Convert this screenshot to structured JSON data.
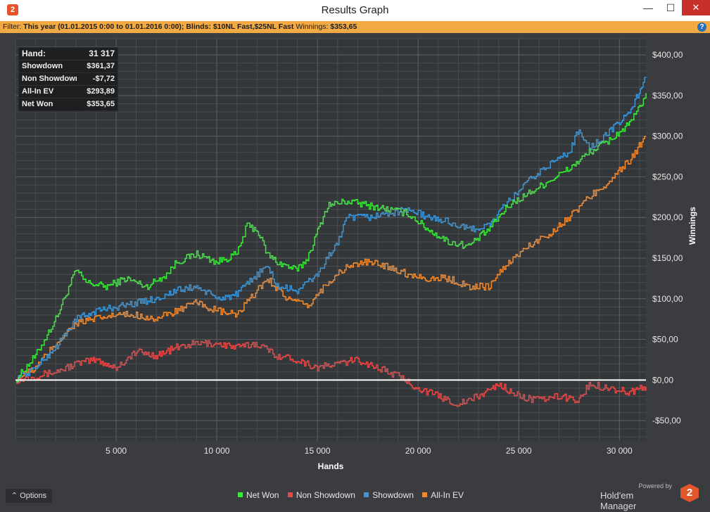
{
  "window": {
    "title": "Results Graph",
    "minimize_glyph": "—",
    "maximize_glyph": "☐",
    "close_glyph": "✕"
  },
  "filter": {
    "label": "Filter:",
    "value": "This year (01.01.2015 0:00 to 01.01.2016 0:00); Blinds: $10NL Fast,$25NL Fast",
    "winnings_label": "Winnings:",
    "winnings_value": "$353,65",
    "help_glyph": "?"
  },
  "stats": [
    {
      "label": "Hand:",
      "value": "31 317"
    },
    {
      "label": "Showdown",
      "value": "$361,37"
    },
    {
      "label": "Non Showdown",
      "value": "-$7,72"
    },
    {
      "label": "All-In EV",
      "value": "$293,89"
    },
    {
      "label": "Net Won",
      "value": "$353,65"
    }
  ],
  "options_button": {
    "label": "Options",
    "icon": "chevron-up-icon"
  },
  "brand": {
    "powered": "Powered by",
    "name": "Hold'em Manager",
    "logo_text": "2"
  },
  "colors": {
    "net_won": "#3ee63e",
    "non_showdown": "#e44a4a",
    "showdown": "#3c95d6",
    "allin_ev": "#f08a32",
    "zero_line": "#ffffff",
    "background": "#3a3c3f",
    "filter_bar": "#f1aa44"
  },
  "chart_data": {
    "type": "line",
    "xlabel": "Hands",
    "ylabel": "Winnings",
    "xlim": [
      0,
      31317
    ],
    "ylim": [
      -75,
      420
    ],
    "x_ticks": [
      5000,
      10000,
      15000,
      20000,
      25000,
      30000
    ],
    "x_tick_labels": [
      "5 000",
      "10 000",
      "15 000",
      "20 000",
      "25 000",
      "30 000"
    ],
    "y_ticks": [
      -50,
      0,
      50,
      100,
      150,
      200,
      250,
      300,
      350,
      400
    ],
    "y_tick_labels": [
      "-$50,00",
      "$0,00",
      "$50,00",
      "$100,00",
      "$150,00",
      "$200,00",
      "$250,00",
      "$300,00",
      "$350,00",
      "$400,00"
    ],
    "grid": true,
    "legend_position": "bottom",
    "series": [
      {
        "name": "Net Won",
        "color": "#3ee63e",
        "x": [
          0,
          1000,
          2000,
          3000,
          3500,
          4500,
          5500,
          6500,
          7500,
          8000,
          9000,
          10000,
          11000,
          11500,
          12000,
          12500,
          13000,
          14000,
          14500,
          15500,
          16500,
          17500,
          18500,
          19500,
          20500,
          21500,
          22500,
          23500,
          24500,
          25500,
          26500,
          27500,
          28500,
          29500,
          30500,
          31000,
          31317
        ],
        "y": [
          0,
          30,
          75,
          135,
          120,
          115,
          125,
          115,
          130,
          145,
          155,
          145,
          155,
          190,
          185,
          155,
          145,
          135,
          150,
          215,
          220,
          215,
          210,
          205,
          185,
          170,
          165,
          185,
          215,
          230,
          245,
          260,
          280,
          295,
          315,
          335,
          353
        ]
      },
      {
        "name": "Non Showdown",
        "color": "#e44a4a",
        "x": [
          0,
          1000,
          2000,
          3000,
          4000,
          5000,
          6000,
          7000,
          8000,
          9000,
          10000,
          11000,
          12000,
          13000,
          14000,
          15000,
          16000,
          17000,
          18000,
          19000,
          20000,
          21000,
          22000,
          23000,
          24000,
          25000,
          26000,
          27000,
          28000,
          28500,
          29500,
          30500,
          31317
        ],
        "y": [
          0,
          5,
          10,
          20,
          25,
          15,
          35,
          30,
          40,
          45,
          45,
          40,
          45,
          30,
          25,
          15,
          20,
          25,
          15,
          5,
          -10,
          -20,
          -30,
          -20,
          -5,
          -20,
          -25,
          -20,
          -25,
          -5,
          -10,
          -15,
          -8
        ]
      },
      {
        "name": "Showdown",
        "color": "#3c95d6",
        "x": [
          0,
          1000,
          2000,
          3000,
          4000,
          5000,
          6000,
          7000,
          8000,
          9000,
          10000,
          11000,
          12000,
          12500,
          13000,
          14000,
          15000,
          16000,
          16500,
          17500,
          18500,
          19500,
          20500,
          21500,
          22500,
          23500,
          24500,
          25500,
          26500,
          27500,
          28000,
          28500,
          29500,
          30500,
          31317
        ],
        "y": [
          0,
          15,
          40,
          75,
          85,
          90,
          95,
          100,
          110,
          115,
          100,
          105,
          130,
          140,
          115,
          110,
          130,
          170,
          200,
          200,
          205,
          210,
          200,
          195,
          185,
          190,
          220,
          245,
          265,
          280,
          310,
          285,
          305,
          330,
          372
        ]
      },
      {
        "name": "All-In EV",
        "color": "#f08a32",
        "x": [
          0,
          1000,
          2000,
          3000,
          4000,
          5000,
          6000,
          7000,
          8000,
          9000,
          10000,
          11000,
          12000,
          12500,
          13500,
          14500,
          15500,
          16500,
          17500,
          18500,
          19500,
          20500,
          21500,
          22500,
          23500,
          24500,
          25500,
          26500,
          27500,
          28500,
          29500,
          30500,
          31317
        ],
        "y": [
          0,
          15,
          45,
          70,
          75,
          80,
          80,
          75,
          85,
          95,
          85,
          80,
          110,
          125,
          100,
          90,
          120,
          140,
          145,
          140,
          130,
          125,
          125,
          115,
          115,
          145,
          165,
          180,
          200,
          225,
          245,
          270,
          300
        ]
      }
    ]
  }
}
